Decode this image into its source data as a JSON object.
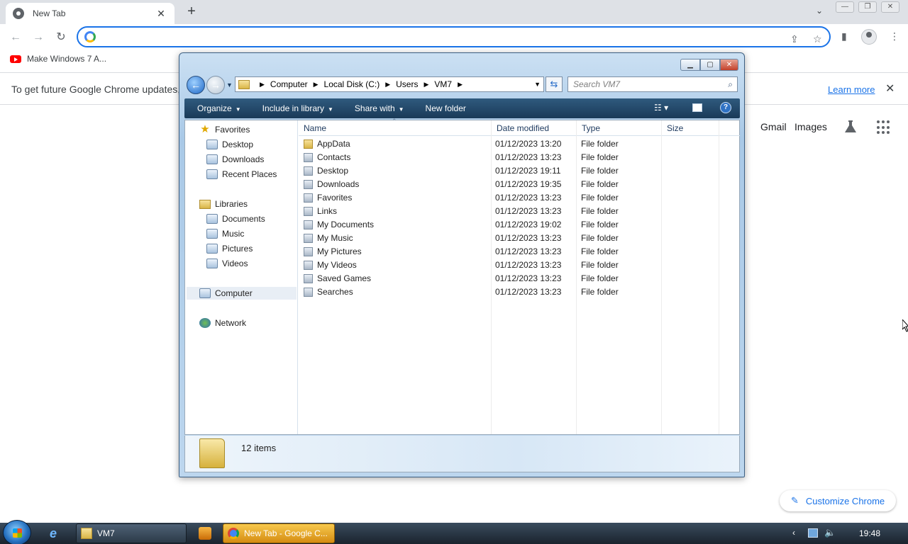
{
  "browser": {
    "tab_title": "New Tab",
    "bookmark": "Make Windows 7 A...",
    "infobar_message": "To get future Google Chrome updates, yo",
    "infobar_link": "Learn more",
    "gmail": "Gmail",
    "images": "Images",
    "customize": "Customize Chrome"
  },
  "explorer": {
    "breadcrumb": [
      "Computer",
      "Local Disk (C:)",
      "Users",
      "VM7"
    ],
    "search_placeholder": "Search VM7",
    "toolbar": {
      "organize": "Organize",
      "include": "Include in library",
      "share": "Share with",
      "newfolder": "New folder"
    },
    "nav": {
      "favorites": "Favorites",
      "desktop": "Desktop",
      "downloads": "Downloads",
      "recent": "Recent Places",
      "libraries": "Libraries",
      "documents": "Documents",
      "music": "Music",
      "pictures": "Pictures",
      "videos": "Videos",
      "computer": "Computer",
      "network": "Network"
    },
    "columns": {
      "name": "Name",
      "date": "Date modified",
      "type": "Type",
      "size": "Size"
    },
    "files": [
      {
        "name": "AppData",
        "date": "01/12/2023 13:20",
        "type": "File folder"
      },
      {
        "name": "Contacts",
        "date": "01/12/2023 13:23",
        "type": "File folder"
      },
      {
        "name": "Desktop",
        "date": "01/12/2023 19:11",
        "type": "File folder"
      },
      {
        "name": "Downloads",
        "date": "01/12/2023 19:35",
        "type": "File folder"
      },
      {
        "name": "Favorites",
        "date": "01/12/2023 13:23",
        "type": "File folder"
      },
      {
        "name": "Links",
        "date": "01/12/2023 13:23",
        "type": "File folder"
      },
      {
        "name": "My Documents",
        "date": "01/12/2023 19:02",
        "type": "File folder"
      },
      {
        "name": "My Music",
        "date": "01/12/2023 13:23",
        "type": "File folder"
      },
      {
        "name": "My Pictures",
        "date": "01/12/2023 13:23",
        "type": "File folder"
      },
      {
        "name": "My Videos",
        "date": "01/12/2023 13:23",
        "type": "File folder"
      },
      {
        "name": "Saved Games",
        "date": "01/12/2023 13:23",
        "type": "File folder"
      },
      {
        "name": "Searches",
        "date": "01/12/2023 13:23",
        "type": "File folder"
      }
    ],
    "status_count": "12 items"
  },
  "taskbar": {
    "vm7": "VM7",
    "chrome": "New Tab - Google C...",
    "clock": "19:48"
  },
  "icons": {
    "chrome_tab": "chrome-icon",
    "youtube": "youtube-icon",
    "explorer_folder": "folder-icon",
    "start": "windows-start-icon"
  }
}
